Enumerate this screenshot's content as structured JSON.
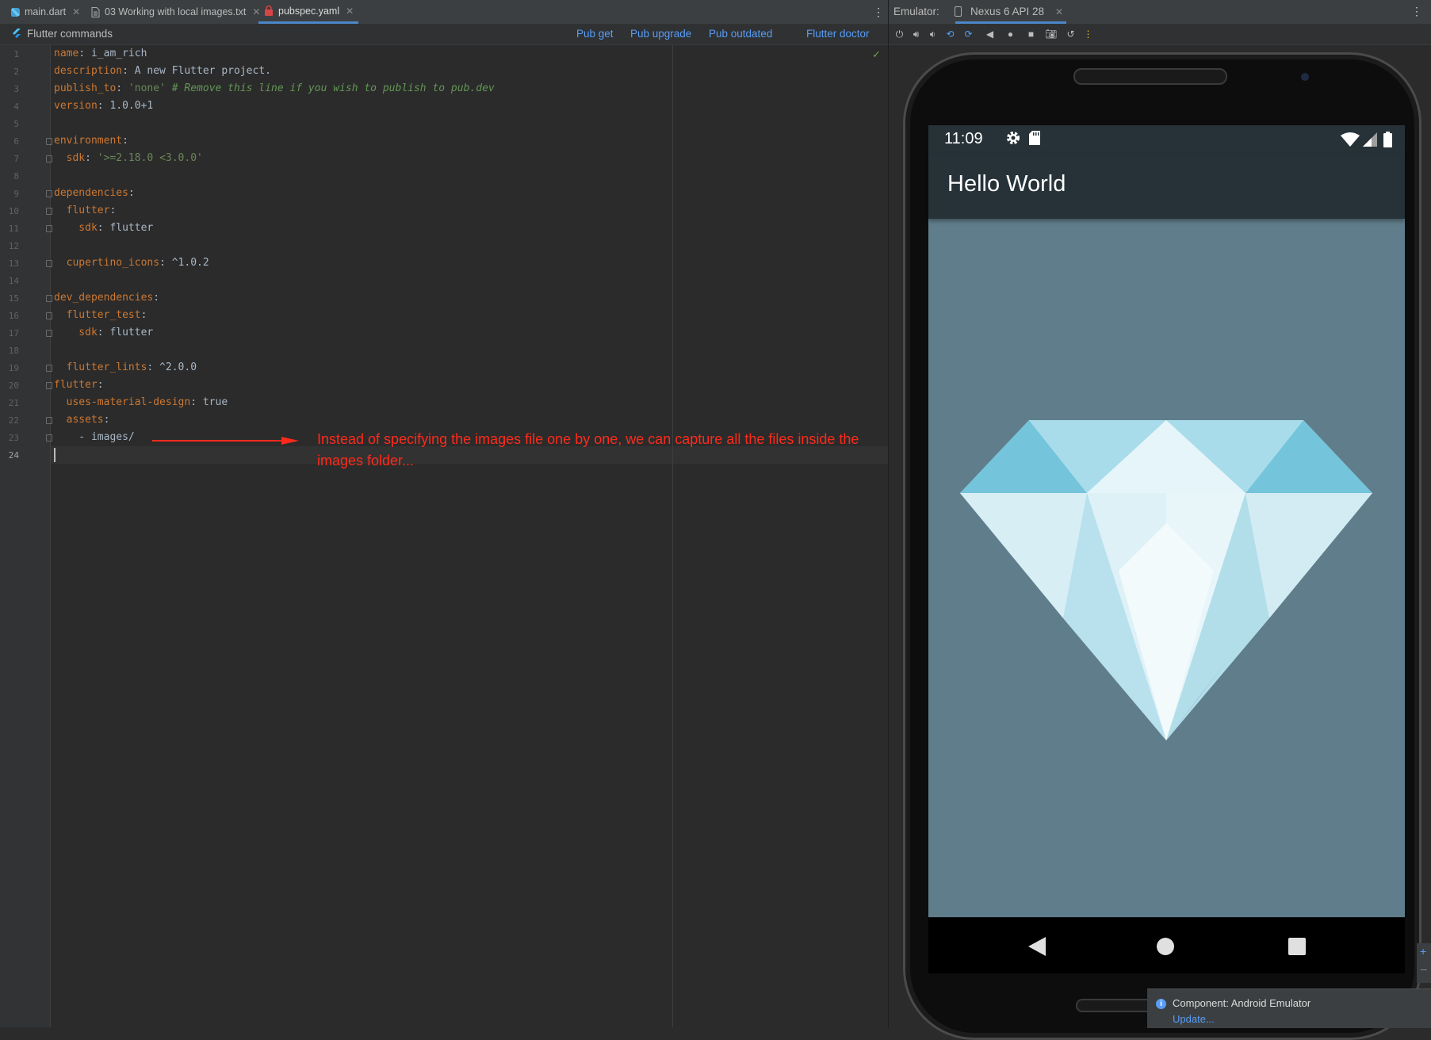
{
  "editor": {
    "tabs": [
      {
        "label": "main.dart",
        "icon": "dart-icon"
      },
      {
        "label": "03 Working with local images.txt",
        "icon": "text-file-icon"
      },
      {
        "label": "pubspec.yaml",
        "icon": "yaml-file-icon"
      }
    ],
    "commands": {
      "title": "Flutter commands",
      "pub_get": "Pub get",
      "pub_upgrade": "Pub upgrade",
      "pub_outdated": "Pub outdated",
      "flutter_doctor": "Flutter doctor"
    },
    "line_numbers": [
      "1",
      "2",
      "3",
      "4",
      "5",
      "6",
      "7",
      "8",
      "9",
      "10",
      "11",
      "12",
      "13",
      "14",
      "15",
      "16",
      "17",
      "18",
      "19",
      "20",
      "21",
      "22",
      "23",
      "24"
    ],
    "code": {
      "l1_key": "name",
      "l1_val": ": i_am_rich",
      "l2_key": "description",
      "l2_val": ": A new Flutter project.",
      "l3_key": "publish_to",
      "l3_sep": ": ",
      "l3_str": "'none'",
      "l3_comment": " # Remove this line if you wish to publish to pub.dev",
      "l4_key": "version",
      "l4_val": ": 1.0.0+1",
      "l6_key": "environment",
      "l6_val": ":",
      "l7_key": "  sdk",
      "l7_sep": ": ",
      "l7_str": "'>=2.18.0 <3.0.0'",
      "l9_key": "dependencies",
      "l9_val": ":",
      "l10_key": "  flutter",
      "l10_val": ":",
      "l11_key": "    sdk",
      "l11_val": ": flutter",
      "l13_key": "  cupertino_icons",
      "l13_val": ": ^1.0.2",
      "l15_key": "dev_dependencies",
      "l15_val": ":",
      "l16_key": "  flutter_test",
      "l16_val": ":",
      "l17_key": "    sdk",
      "l17_val": ": flutter",
      "l19_key": "  flutter_lints",
      "l19_val": ": ^2.0.0",
      "l20_key": "flutter",
      "l20_val": ":",
      "l21_key": "  uses-material-design",
      "l21_val": ": true",
      "l22_key": "  assets",
      "l22_val": ":",
      "l23_val": "    - images/"
    },
    "annotation": "Instead of specifying the images file one by one, we can capture all the files inside the images folder...",
    "annotation_color": "#ff2a1a"
  },
  "emulator": {
    "label": "Emulator:",
    "device": "Nexus 6 API 28",
    "phone": {
      "time": "11:09",
      "app_title": "Hello World",
      "appbar_color": "#263238",
      "body_color": "#607d8b"
    }
  },
  "notification": {
    "title": "Component: Android Emulator",
    "link": "Update..."
  }
}
